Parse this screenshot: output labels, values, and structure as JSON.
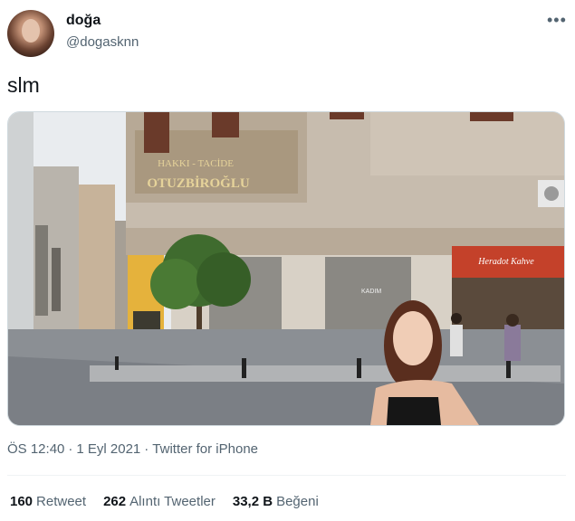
{
  "user": {
    "display_name": "doğa",
    "handle": "@dogasknn"
  },
  "tweet": {
    "text": "slm",
    "sign_texts": {
      "shop_sign_line1": "HAKKI - TACİDE",
      "shop_sign_line2": "OTUZBİROĞLU",
      "cafe_sign": "Heradot Kahve",
      "window_text": "KADIM"
    }
  },
  "meta": {
    "time": "ÖS 12:40",
    "date": "1 Eyl 2021",
    "source": "Twitter for iPhone",
    "separator": "·"
  },
  "stats": {
    "retweets_count": "160",
    "retweets_label": "Retweet",
    "quotes_count": "262",
    "quotes_label": "Alıntı Tweetler",
    "likes_count": "33,2 B",
    "likes_label": "Beğeni"
  },
  "icons": {
    "more": "more-horizontal-icon"
  },
  "colors": {
    "text": "#0f1419",
    "secondary": "#536471",
    "cafe_awning": "#c4412a"
  }
}
